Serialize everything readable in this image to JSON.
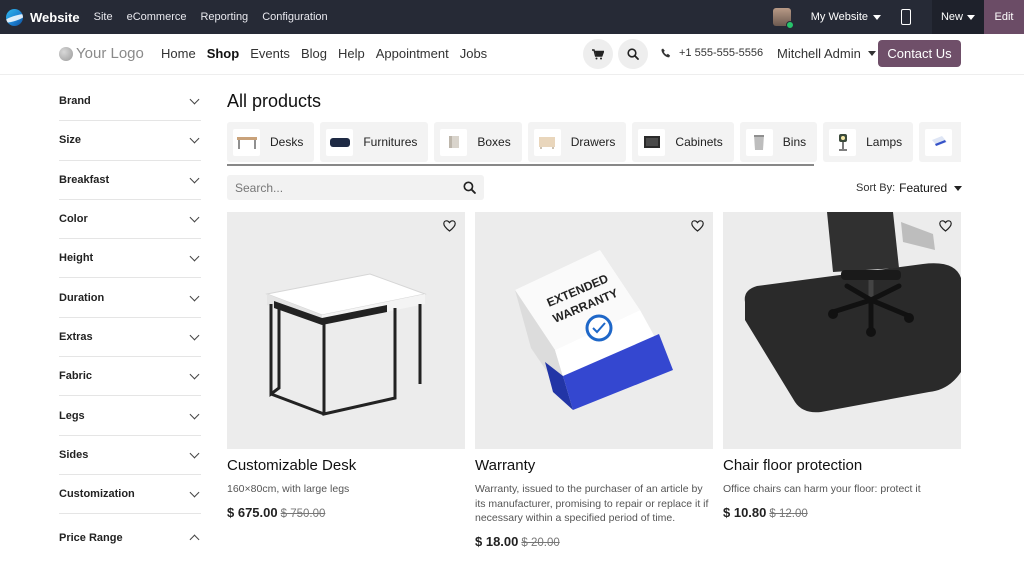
{
  "topbar": {
    "app_name": "Website",
    "menu": [
      "Site",
      "eCommerce",
      "Reporting",
      "Configuration"
    ],
    "site_selector": "My Website",
    "new_label": "New",
    "edit_label": "Edit"
  },
  "header": {
    "logo_text": "Your Logo",
    "nav": [
      "Home",
      "Shop",
      "Events",
      "Blog",
      "Help",
      "Appointment",
      "Jobs"
    ],
    "active_nav": "Shop",
    "phone": "+1 555-555-5556",
    "user": "Mitchell Admin",
    "contact_label": "Contact Us"
  },
  "sidebar": {
    "facets": [
      "Brand",
      "Size",
      "Breakfast",
      "Color",
      "Height",
      "Duration",
      "Extras",
      "Fabric",
      "Legs",
      "Sides",
      "Customization"
    ],
    "price_range": "Price Range"
  },
  "main": {
    "title": "All products",
    "categories": [
      "Desks",
      "Furnitures",
      "Boxes",
      "Drawers",
      "Cabinets",
      "Bins",
      "Lamps",
      ""
    ],
    "search_placeholder": "Search...",
    "sort_label": "Sort By:",
    "sort_value": "Featured"
  },
  "products": [
    {
      "name": "Customizable Desk",
      "desc": "160×80cm, with large legs",
      "price": "$ 675.00",
      "old_price": "$ 750.00"
    },
    {
      "name": "Warranty",
      "desc": "Warranty, issued to the purchaser of an article by its manufacturer, promising to repair or replace it if necessary within a specified period of time.",
      "price": "$ 18.00",
      "old_price": "$ 20.00"
    },
    {
      "name": "Chair floor protection",
      "desc": "Office chairs can harm your floor: protect it",
      "price": "$ 10.80",
      "old_price": "$ 12.00"
    }
  ],
  "warranty_box_text": [
    "EXTENDED",
    "WARRANTY"
  ],
  "colors": {
    "topbar": "#262a36",
    "edit": "#6b4c66",
    "primary": "#6f4f69",
    "online": "#27c36b"
  }
}
